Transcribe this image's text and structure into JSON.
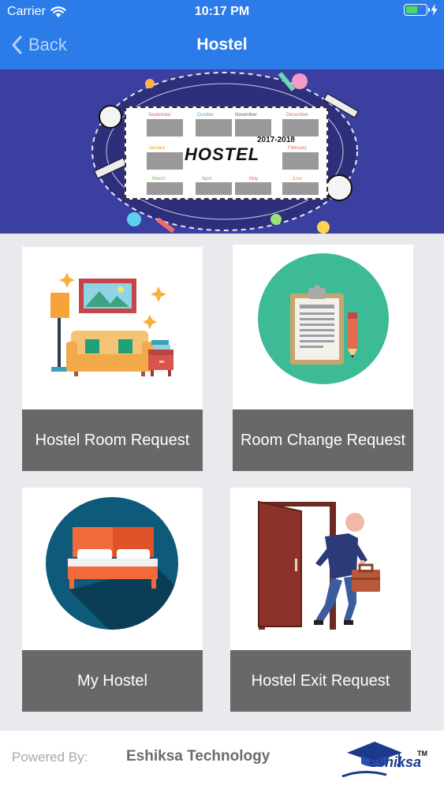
{
  "status_bar": {
    "carrier": "Carrier",
    "time": "10:17 PM"
  },
  "nav": {
    "back_label": "Back",
    "title": "Hostel"
  },
  "banner": {
    "title": "HOSTEL",
    "year": "2017-2018"
  },
  "tiles": [
    {
      "label": "Hostel Room Request",
      "icon": "room-request-icon"
    },
    {
      "label": "Room Change Request",
      "icon": "clipboard-icon"
    },
    {
      "label": "My Hostel",
      "icon": "bed-icon"
    },
    {
      "label": "Hostel Exit Request",
      "icon": "exit-door-icon"
    }
  ],
  "footer": {
    "powered_by": "Powered By:",
    "company": "Eshiksa Technology",
    "logo_text": "eshiksa",
    "logo_tm": "TM"
  },
  "colors": {
    "nav_bar": "#2b7ce9",
    "tile_label_bg": "#686868",
    "page_bg": "#e9e9ee",
    "banner_bg": "#3a3fa0"
  }
}
